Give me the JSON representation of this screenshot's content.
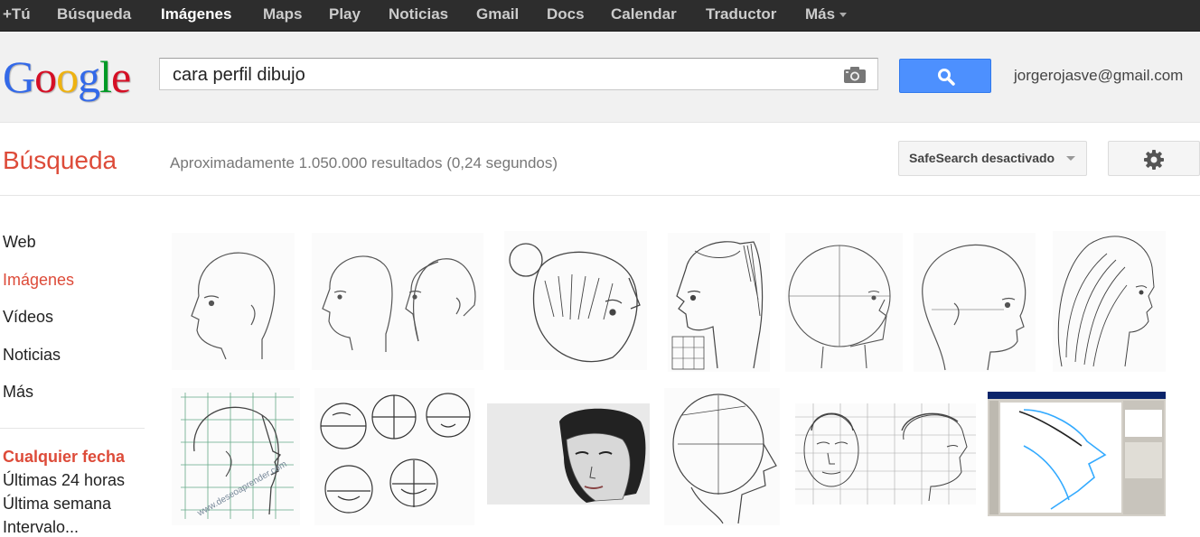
{
  "topnav": {
    "items": [
      {
        "label": "+Tú"
      },
      {
        "label": "Búsqueda"
      },
      {
        "label": "Imágenes"
      },
      {
        "label": "Maps"
      },
      {
        "label": "Play"
      },
      {
        "label": "Noticias"
      },
      {
        "label": "Gmail"
      },
      {
        "label": "Docs"
      },
      {
        "label": "Calendar"
      },
      {
        "label": "Traductor"
      },
      {
        "label": "Más"
      }
    ],
    "active": "Imágenes"
  },
  "logo": {
    "text": "Google"
  },
  "search": {
    "query": "cara perfil dibujo",
    "camera_icon": "camera-icon",
    "button_icon": "search-icon"
  },
  "user": {
    "email": "jorgerojasve@gmail.com"
  },
  "subbar": {
    "title": "Búsqueda",
    "result_stats": "Aproximadamente 1.050.000 resultados (0,24 segundos)",
    "safesearch_label": "SafeSearch desactivado",
    "settings_icon": "gear-icon"
  },
  "leftnav": {
    "items": [
      {
        "label": "Web"
      },
      {
        "label": "Imágenes"
      },
      {
        "label": "Vídeos"
      },
      {
        "label": "Noticias"
      },
      {
        "label": "Más"
      }
    ],
    "active": "Imágenes"
  },
  "filters": {
    "heading": "Cualquier fecha",
    "items": [
      {
        "label": "Últimas 24 horas"
      },
      {
        "label": "Última semana"
      },
      {
        "label": "Intervalo..."
      }
    ]
  },
  "results": {
    "thumbnails": [
      {
        "subject": "bald head profile sketch"
      },
      {
        "subject": "two head profiles sketch"
      },
      {
        "subject": "girl with bun back view"
      },
      {
        "subject": "woman ponytail profile"
      },
      {
        "subject": "head profile construction"
      },
      {
        "subject": "bald head profile"
      },
      {
        "subject": "woman long hair profile"
      },
      {
        "subject": "head profile on grid",
        "watermark": "www.deseoaprender.com"
      },
      {
        "subject": "head rotation studies"
      },
      {
        "subject": "woman face photo"
      },
      {
        "subject": "head construction profile"
      },
      {
        "subject": "face front and profile on grid"
      },
      {
        "subject": "digital drawing of profile"
      }
    ]
  },
  "colors": {
    "topbar_bg": "#2d2d2d",
    "accent_red": "#dd4b39",
    "search_button": "#4d90fe",
    "logo_blue": "#3369e8",
    "logo_red": "#d50f25",
    "logo_yellow": "#eeb211",
    "logo_green": "#009925"
  }
}
